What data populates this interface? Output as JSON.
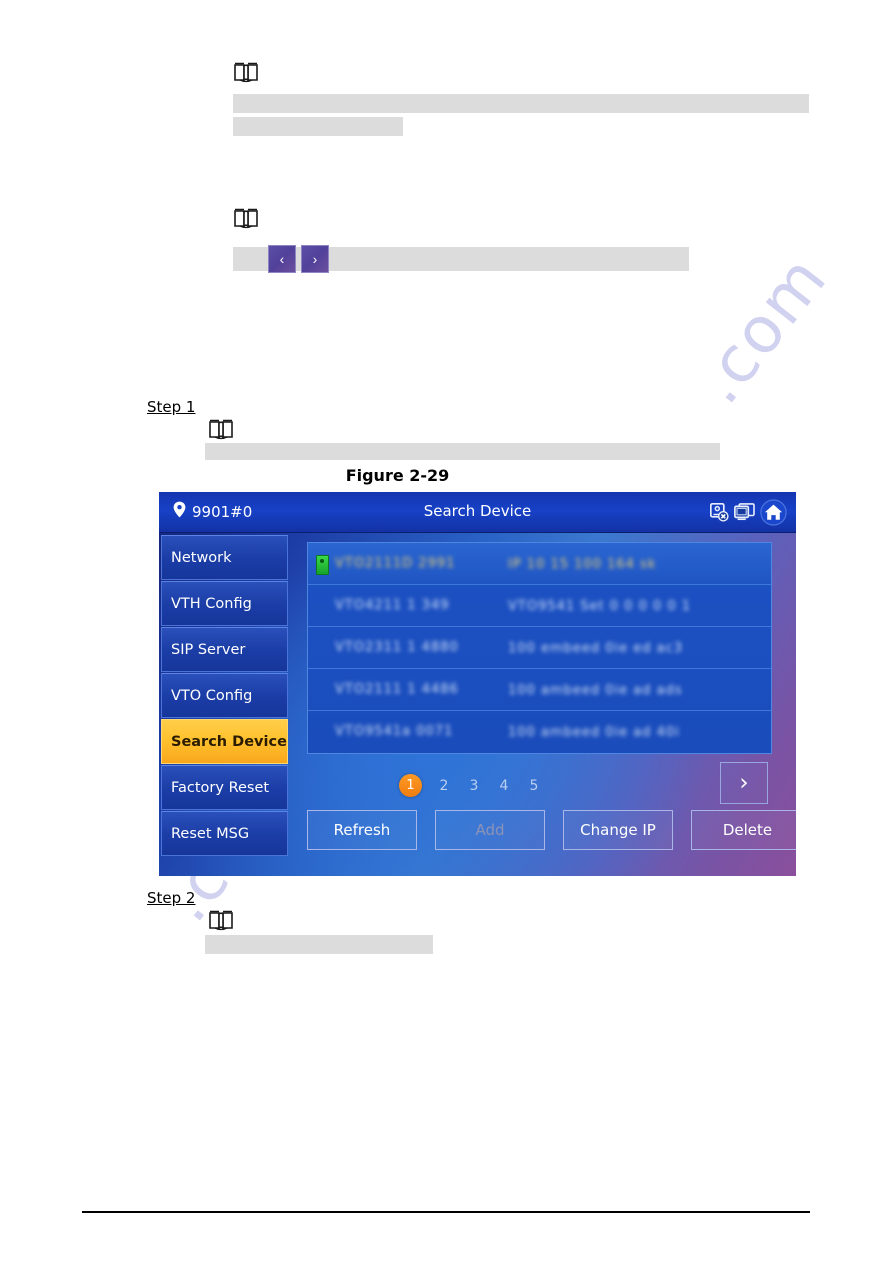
{
  "document": {
    "figure_caption": "Figure 2-29",
    "step1_label": "Step 1",
    "step2_label": "Step 2",
    "note_icon_name": "note-book-icon",
    "nav_prev_label": "‹",
    "nav_next_label": "›",
    "watermark_text": ".com"
  },
  "device": {
    "header": {
      "location": "9901#0",
      "title": "Search Device",
      "icons": [
        "no-call-icon",
        "monitor-icon",
        "home-icon"
      ]
    },
    "sidebar": {
      "items": [
        {
          "label": "Network",
          "active": false
        },
        {
          "label": "VTH Config",
          "active": false
        },
        {
          "label": "SIP Server",
          "active": false
        },
        {
          "label": "VTO Config",
          "active": false
        },
        {
          "label": "Search Device",
          "active": true
        },
        {
          "label": "Factory Reset",
          "active": false
        },
        {
          "label": "Reset MSG",
          "active": false
        }
      ]
    },
    "list": {
      "rows": [
        {
          "status": "online",
          "name": "VTO2111D 2991",
          "detail": "IP 10 15 100 164 sk",
          "redacted": true
        },
        {
          "status": "",
          "name": "VTO4211 1 349",
          "detail": "VTO9541 Set 0 0 0 0 0 1",
          "redacted": true
        },
        {
          "status": "",
          "name": "VTO2311 1 4880",
          "detail": "100 embeed 0ie ed ac3",
          "redacted": true
        },
        {
          "status": "",
          "name": "VTO2111 1 4486",
          "detail": "100 ambeed 0ie ad ads",
          "redacted": true
        },
        {
          "status": "",
          "name": "VTO9541a 0071",
          "detail": "100 ambeed 0ie ad 40i",
          "redacted": true
        }
      ]
    },
    "pagination": {
      "pages": [
        "1",
        "2",
        "3",
        "4",
        "5"
      ],
      "current": "1",
      "next_label": "›"
    },
    "buttons": [
      {
        "label": "Refresh",
        "disabled": false
      },
      {
        "label": "Add",
        "disabled": true
      },
      {
        "label": "Change IP",
        "disabled": false
      },
      {
        "label": "Delete",
        "disabled": false
      }
    ]
  },
  "colors": {
    "accent_orange": "#f9a61c",
    "header_blue": "#1741c6",
    "panel_blue": "#1b3da6",
    "redaction_grey": "#dcdcdc",
    "purple_button": "#52419a"
  }
}
